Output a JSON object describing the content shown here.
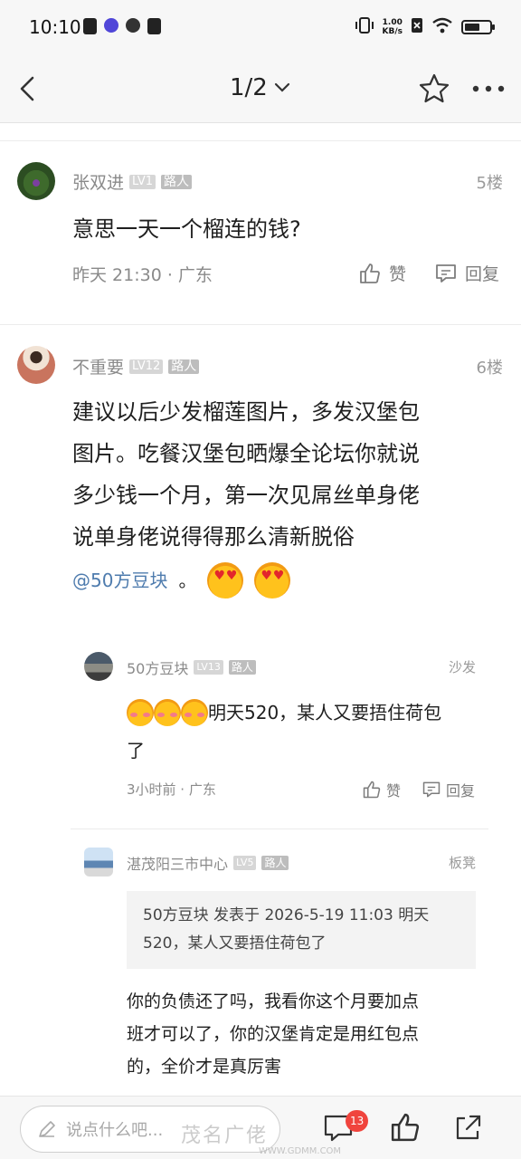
{
  "status": {
    "time": "10:10",
    "net_speed_value": "1.00",
    "net_speed_unit": "KB/s"
  },
  "nav": {
    "page_indicator": "1/2"
  },
  "posts": [
    {
      "username": "张双进",
      "level": "LV1",
      "role": "路人",
      "floor": "5楼",
      "content": "意思一天一个榴连的钱?",
      "meta": "昨天 21:30 · 广东",
      "like_label": "赞",
      "reply_label": "回复"
    },
    {
      "username": "不重要",
      "level": "LV12",
      "role": "路人",
      "floor": "6楼",
      "content_lines": [
        "建议以后少发榴莲图片，多发汉堡包",
        "图片。吃餐汉堡包晒爆全论坛你就说",
        "多少钱一个月，第一次见屌丝单身佬",
        "说单身佬说得得那么清新脱俗"
      ],
      "mention": "@50方豆块",
      "mention_suffix": "。",
      "emoji_name": "heart-eyes-emoji"
    }
  ],
  "replies": [
    {
      "username": "50方豆块",
      "level": "LV13",
      "role": "路人",
      "floor": "沙发",
      "content_line1": "明天520，某人又要捂住荷包",
      "content_line2": "了",
      "emoji_name": "blush-emoji",
      "meta": "3小时前 · 广东",
      "like_label": "赞",
      "reply_label": "回复"
    },
    {
      "username": "湛茂阳三市中心",
      "level": "LV5",
      "role": "路人",
      "floor": "板凳",
      "quote_line1": "50方豆块 发表于 2026-5-19 11:03 明天",
      "quote_line2": "520，某人又要捂住荷包了",
      "content_lines": [
        "你的负债还了吗，我看你这个月要加点",
        "班才可以了，你的汉堡肯定是用红包点",
        "的，全价才是真厉害"
      ]
    }
  ],
  "bottom": {
    "input_placeholder": "说点什么吧...",
    "comment_count": "13"
  },
  "watermark": {
    "text": "茂名广佬",
    "sub": "WWW.GDMM.COM"
  },
  "colors": {
    "mention": "#4f7cae",
    "badge_red": "#f0443d"
  }
}
